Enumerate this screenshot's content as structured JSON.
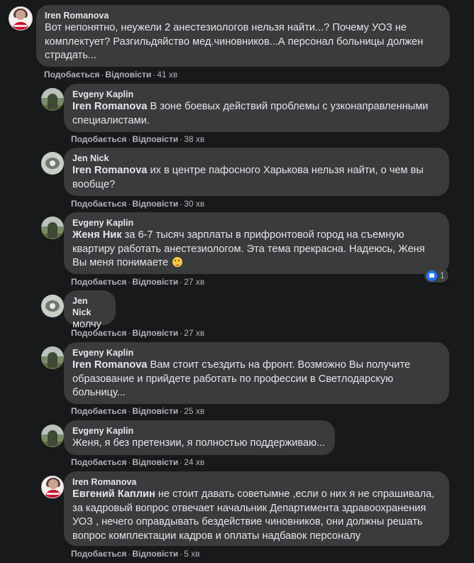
{
  "like_label": "Подобається",
  "reply_label": "Відповісти",
  "comments": [
    {
      "author": "Iren Romanova",
      "mention": "",
      "text": "Вот непонятно, неужели 2 анестезиологов нельзя найти...? Почему УОЗ не комплектует? Разгильдяйство мед.чиновников...А персонал больницы должен страдать...",
      "time": "41 хв"
    },
    {
      "author": "Evgeny Kaplin",
      "mention": "Iren Romanova",
      "text": "В зоне боевых действий проблемы с узконаправленными специалистами.",
      "time": "38 хв"
    },
    {
      "author": "Jen Nick",
      "mention": "Iren Romanova",
      "text": "их в центре пафосного Харькова нельзя найти, о чем вы вообще?",
      "time": "30 хв"
    },
    {
      "author": "Evgeny Kaplin",
      "mention": "Женя Ник",
      "text": "за 6-7 тысяч зарплаты в прифронтовой город на съемную квартиру работать анестезиологом. Эта тема прекрасна. Надеюсь, Женя Вы меня понимаете",
      "time": "27 хв",
      "reaction_count": "1"
    },
    {
      "author": "Jen Nick",
      "mention": "",
      "text": "молчу",
      "time": "27 хв"
    },
    {
      "author": "Evgeny Kaplin",
      "mention": "Iren Romanova",
      "text": "Вам стоит съездить на фронт. Возможно Вы получите образование и прийдете работать по профессии в Светлодарскую больницу...",
      "time": "25 хв"
    },
    {
      "author": "Evgeny Kaplin",
      "mention": "",
      "text": "Женя, я без претензии, я полностью поддерживаю...",
      "time": "24 хв"
    },
    {
      "author": "Iren Romanova",
      "mention": "Евгений Каплин",
      "text": "не стоит давать советымне ,если о них я не спрашивала, за кадровый вопрос отвечает начальник Департимента здравоохранения УОЗ , нечего оправдывать бездействие чиновников, они должны решать вопрос комплектации кадров и оплаты надбавок персоналу",
      "time": "5 хв"
    }
  ]
}
